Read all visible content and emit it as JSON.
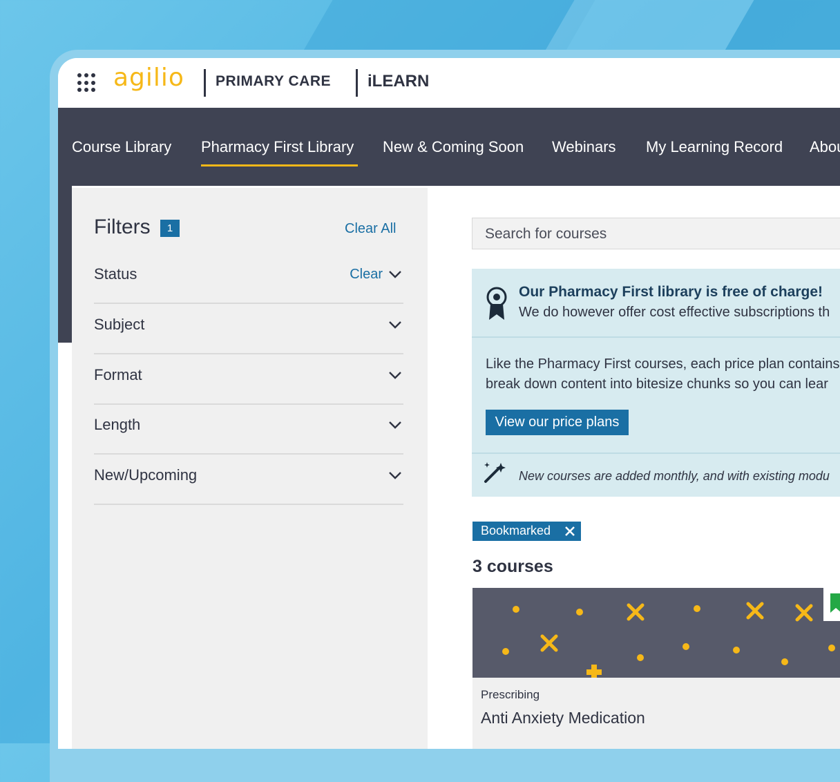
{
  "brand": {
    "logo_text": "agilio",
    "product_name": "PRIMARY CARE",
    "app_name": "iLEARN",
    "accent_color": "#f6b818",
    "nav_color": "#3f4353",
    "link_color": "#1a6fa4"
  },
  "nav": {
    "items": [
      {
        "label": "Course Library"
      },
      {
        "label": "Pharmacy First Library"
      },
      {
        "label": "New & Coming Soon"
      },
      {
        "label": "Webinars"
      },
      {
        "label": "My Learning Record"
      },
      {
        "label": "About"
      }
    ],
    "active": "Pharmacy First Library"
  },
  "filters": {
    "title": "Filters",
    "badge_count": "1",
    "clear_all": "Clear All",
    "groups": [
      {
        "label": "Status",
        "clear": "Clear"
      },
      {
        "label": "Subject"
      },
      {
        "label": "Format"
      },
      {
        "label": "Length"
      },
      {
        "label": "New/Upcoming"
      }
    ]
  },
  "search": {
    "placeholder": "Search for courses"
  },
  "promo": {
    "heading": "Our Pharmacy First library is free of charge!",
    "subtext": "We do however offer cost effective subscriptions th",
    "body_line1": "Like the Pharmacy First courses, each price plan contains",
    "body_line2": "break down content into bitesize chunks so you can lear",
    "button": "View our price plans",
    "note": "New courses are added monthly, and with existing modu"
  },
  "active_tags": [
    {
      "label": "Bookmarked"
    }
  ],
  "results": {
    "count_text": "3 courses",
    "courses": [
      {
        "category": "Prescribing",
        "title": "Anti Anxiety Medication",
        "bookmarked": true
      }
    ]
  },
  "icons": [
    "apps-grid-icon",
    "chevron-down-icon",
    "award-ribbon-icon",
    "magic-wand-icon",
    "close-icon",
    "bookmark-icon"
  ]
}
